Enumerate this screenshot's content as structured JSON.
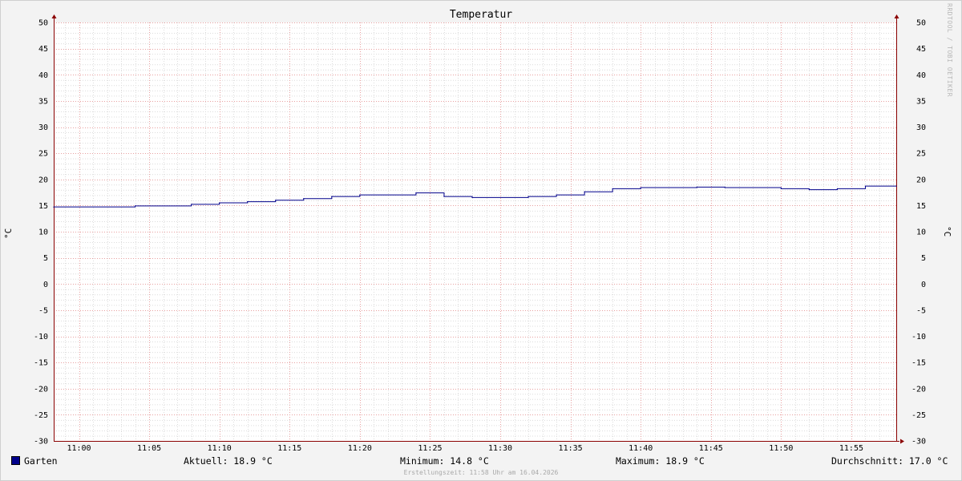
{
  "chart_data": {
    "type": "line",
    "title": "Temperatur",
    "ylabel": "°C",
    "ylabel_right": "°C",
    "ylim": [
      -30,
      50
    ],
    "y_ticks": [
      -30,
      -25,
      -20,
      -15,
      -10,
      -5,
      0,
      5,
      10,
      15,
      20,
      25,
      30,
      35,
      40,
      45,
      50
    ],
    "x_tick_labels": [
      "11:00",
      "11:05",
      "11:10",
      "11:15",
      "11:20",
      "11:25",
      "11:30",
      "11:35",
      "11:40",
      "11:45",
      "11:50",
      "11:55"
    ],
    "x_minute_range": [
      58.2,
      118.2
    ],
    "x_tick_minutes": [
      60,
      65,
      70,
      75,
      80,
      85,
      90,
      95,
      100,
      105,
      110,
      115
    ],
    "step": "hv",
    "grid": true,
    "series": [
      {
        "name": "Garten",
        "color": "#00008b",
        "x": [
          58.2,
          64,
          68,
          70,
          72,
          74,
          76,
          78,
          80,
          84,
          86,
          88,
          92,
          94,
          96,
          98,
          100,
          104,
          106,
          110,
          112,
          114,
          116,
          118.2
        ],
        "values": [
          14.8,
          15.0,
          15.3,
          15.6,
          15.8,
          16.1,
          16.4,
          16.8,
          17.1,
          17.5,
          16.8,
          16.6,
          16.8,
          17.1,
          17.7,
          18.3,
          18.5,
          18.6,
          18.5,
          18.3,
          18.1,
          18.3,
          18.8,
          18.8
        ]
      }
    ]
  },
  "legend": {
    "series_name": "Garten",
    "aktuell": "Aktuell: 18.9 °C",
    "minimum": "Minimum: 14.8 °C",
    "maximum": "Maximum: 18.9 °C",
    "durchschnitt": "Durchschnitt: 17.0 °C"
  },
  "footer": "Erstellungszeit: 11:58 Uhr am 16.04.2026",
  "watermark": "RRDTOOL / TOBI OETIKER"
}
